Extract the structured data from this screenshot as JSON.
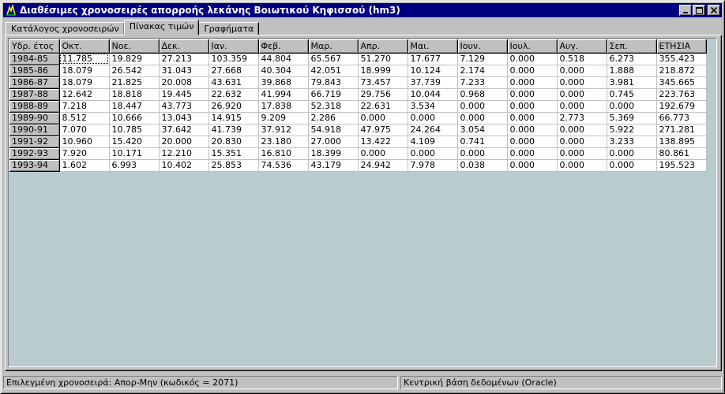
{
  "window": {
    "title": "Διαθέσιμες χρονοσειρές απορροής λεκάνης Βοιωτικού Κηφισσού (hm3)"
  },
  "tabs": [
    {
      "label": "Κατάλογος χρονοσειρών",
      "active": false
    },
    {
      "label": "Πίνακας τιμών",
      "active": true
    },
    {
      "label": "Γραφήματα",
      "active": false
    }
  ],
  "table": {
    "headers": [
      "Υδρ. έτος",
      "Οκτ.",
      "Νοε.",
      "Δεκ.",
      "Ιαν.",
      "Φεβ.",
      "Μαρ.",
      "Απρ.",
      "Μαι.",
      "Ιουν.",
      "Ιουλ.",
      "Αυγ.",
      "Σεπ.",
      "ΕΤΗΣΙΑ"
    ],
    "rows": [
      [
        "1984-85",
        "11.785",
        "19.829",
        "27.213",
        "103.359",
        "44.804",
        "65.567",
        "51.270",
        "17.677",
        "7.129",
        "0.000",
        "0.518",
        "6.273",
        "355.423"
      ],
      [
        "1985-86",
        "18.079",
        "26.542",
        "31.043",
        "27.668",
        "40.304",
        "42.051",
        "18.999",
        "10.124",
        "2.174",
        "0.000",
        "0.000",
        "1.888",
        "218.872"
      ],
      [
        "1986-87",
        "18.079",
        "21.825",
        "20.008",
        "43.631",
        "39.868",
        "79.843",
        "73.457",
        "37.739",
        "7.233",
        "0.000",
        "0.000",
        "3.981",
        "345.665"
      ],
      [
        "1987-88",
        "12.642",
        "18.818",
        "19.445",
        "22.632",
        "41.994",
        "66.719",
        "29.756",
        "10.044",
        "0.968",
        "0.000",
        "0.000",
        "0.745",
        "223.763"
      ],
      [
        "1988-89",
        "7.218",
        "18.447",
        "43.773",
        "26.920",
        "17.838",
        "52.318",
        "22.631",
        "3.534",
        "0.000",
        "0.000",
        "0.000",
        "0.000",
        "192.679"
      ],
      [
        "1989-90",
        "8.512",
        "10.666",
        "13.043",
        "14.915",
        "9.209",
        "2.286",
        "0.000",
        "0.000",
        "0.000",
        "0.000",
        "2.773",
        "5.369",
        "66.773"
      ],
      [
        "1990-91",
        "7.070",
        "10.785",
        "37.642",
        "41.739",
        "37.912",
        "54.918",
        "47.975",
        "24.264",
        "3.054",
        "0.000",
        "0.000",
        "5.922",
        "271.281"
      ],
      [
        "1991-92",
        "10.960",
        "15.420",
        "20.000",
        "20.830",
        "23.180",
        "27.000",
        "13.422",
        "4.109",
        "0.741",
        "0.000",
        "0.000",
        "3.233",
        "138.895"
      ],
      [
        "1992-93",
        "7.920",
        "10.171",
        "12.210",
        "15.351",
        "16.810",
        "18.399",
        "0.000",
        "0.000",
        "0.000",
        "0.000",
        "0.000",
        "0.000",
        "80.861"
      ],
      [
        "1993-94",
        "1.602",
        "6.993",
        "10.402",
        "25.853",
        "74.536",
        "43.179",
        "24.942",
        "7.978",
        "0.038",
        "0.000",
        "0.000",
        "0.000",
        "195.523"
      ]
    ]
  },
  "status": {
    "left": "Επιλεγμένη χρονοσειρά: Απορ-Μην (κωδικός = 2071)",
    "right": "Κεντρική βάση δεδομένων (Oracle)"
  },
  "colors": {
    "titlebar": "#000080",
    "workspace": "#b8cbcd",
    "face": "#c0c0c0"
  }
}
